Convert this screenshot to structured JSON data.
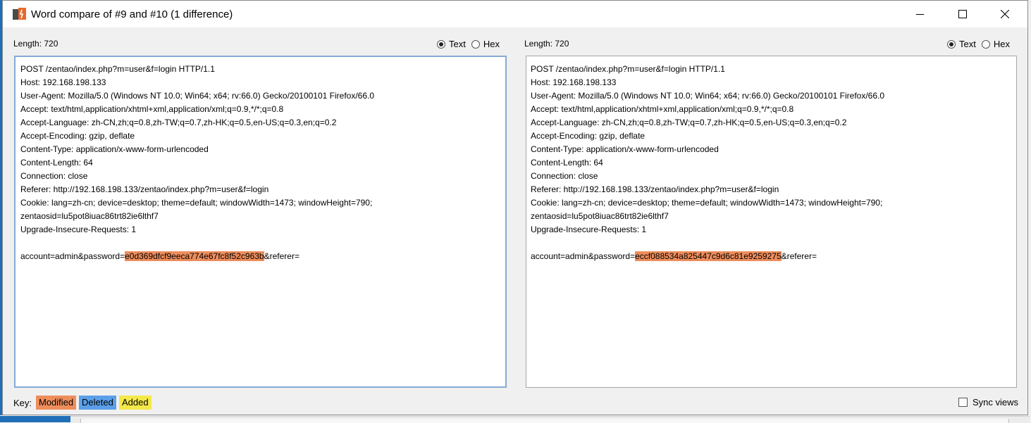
{
  "window": {
    "title": "Word compare of #9 and #10  (1 difference)"
  },
  "left": {
    "length_label": "Length: 720",
    "view_options": [
      {
        "label": "Text",
        "selected": true
      },
      {
        "label": "Hex",
        "selected": false
      }
    ],
    "lines": [
      [
        {
          "t": "POST /zentao/index.php?m=user&f=login HTTP/1.1"
        }
      ],
      [
        {
          "t": "Host: 192.168.198.133"
        }
      ],
      [
        {
          "t": "User-Agent: Mozilla/5.0 (Windows NT 10.0; Win64; x64; rv:66.0) Gecko/20100101 Firefox/66.0"
        }
      ],
      [
        {
          "t": "Accept: text/html,application/xhtml+xml,application/xml;q=0.9,*/*;q=0.8"
        }
      ],
      [
        {
          "t": "Accept-Language: zh-CN,zh;q=0.8,zh-TW;q=0.7,zh-HK;q=0.5,en-US;q=0.3,en;q=0.2"
        }
      ],
      [
        {
          "t": "Accept-Encoding: gzip, deflate"
        }
      ],
      [
        {
          "t": "Content-Type: application/x-www-form-urlencoded"
        }
      ],
      [
        {
          "t": "Content-Length: 64"
        }
      ],
      [
        {
          "t": "Connection: close"
        }
      ],
      [
        {
          "t": "Referer: http://192.168.198.133/zentao/index.php?m=user&f=login"
        }
      ],
      [
        {
          "t": "Cookie: lang=zh-cn; device=desktop; theme=default; windowWidth=1473; windowHeight=790;"
        }
      ],
      [
        {
          "t": "zentaosid=lu5pot8iuac86trt82ie6lthf7"
        }
      ],
      [
        {
          "t": "Upgrade-Insecure-Requests: 1"
        }
      ],
      [
        {
          "t": ""
        }
      ],
      [
        {
          "t": "account=admin&password="
        },
        {
          "t": "e0d369dfcf9eeca774e67fc8f52c963b",
          "hl": "modified"
        },
        {
          "t": "&referer="
        }
      ]
    ]
  },
  "right": {
    "length_label": "Length: 720",
    "view_options": [
      {
        "label": "Text",
        "selected": true
      },
      {
        "label": "Hex",
        "selected": false
      }
    ],
    "lines": [
      [
        {
          "t": "POST /zentao/index.php?m=user&f=login HTTP/1.1"
        }
      ],
      [
        {
          "t": "Host: 192.168.198.133"
        }
      ],
      [
        {
          "t": "User-Agent: Mozilla/5.0 (Windows NT 10.0; Win64; x64; rv:66.0) Gecko/20100101 Firefox/66.0"
        }
      ],
      [
        {
          "t": "Accept: text/html,application/xhtml+xml,application/xml;q=0.9,*/*;q=0.8"
        }
      ],
      [
        {
          "t": "Accept-Language: zh-CN,zh;q=0.8,zh-TW;q=0.7,zh-HK;q=0.5,en-US;q=0.3,en;q=0.2"
        }
      ],
      [
        {
          "t": "Accept-Encoding: gzip, deflate"
        }
      ],
      [
        {
          "t": "Content-Type: application/x-www-form-urlencoded"
        }
      ],
      [
        {
          "t": "Content-Length: 64"
        }
      ],
      [
        {
          "t": "Connection: close"
        }
      ],
      [
        {
          "t": "Referer: http://192.168.198.133/zentao/index.php?m=user&f=login"
        }
      ],
      [
        {
          "t": "Cookie: lang=zh-cn; device=desktop; theme=default; windowWidth=1473; windowHeight=790;"
        }
      ],
      [
        {
          "t": "zentaosid=lu5pot8iuac86trt82ie6lthf7"
        }
      ],
      [
        {
          "t": "Upgrade-Insecure-Requests: 1"
        }
      ],
      [
        {
          "t": ""
        }
      ],
      [
        {
          "t": "account=admin&password="
        },
        {
          "t": "eccf088534a825447c9d6c81e9259275",
          "hl": "modified"
        },
        {
          "t": "&referer="
        }
      ]
    ]
  },
  "key": {
    "label": "Key:",
    "modified": "Modified",
    "deleted": "Deleted",
    "added": "Added"
  },
  "sync_views": {
    "label": "Sync views",
    "checked": false
  },
  "colors": {
    "modified": "#ee8d5c",
    "deleted": "#5b9fe8",
    "added": "#f4e84a",
    "focus_border": "#86aad6"
  }
}
